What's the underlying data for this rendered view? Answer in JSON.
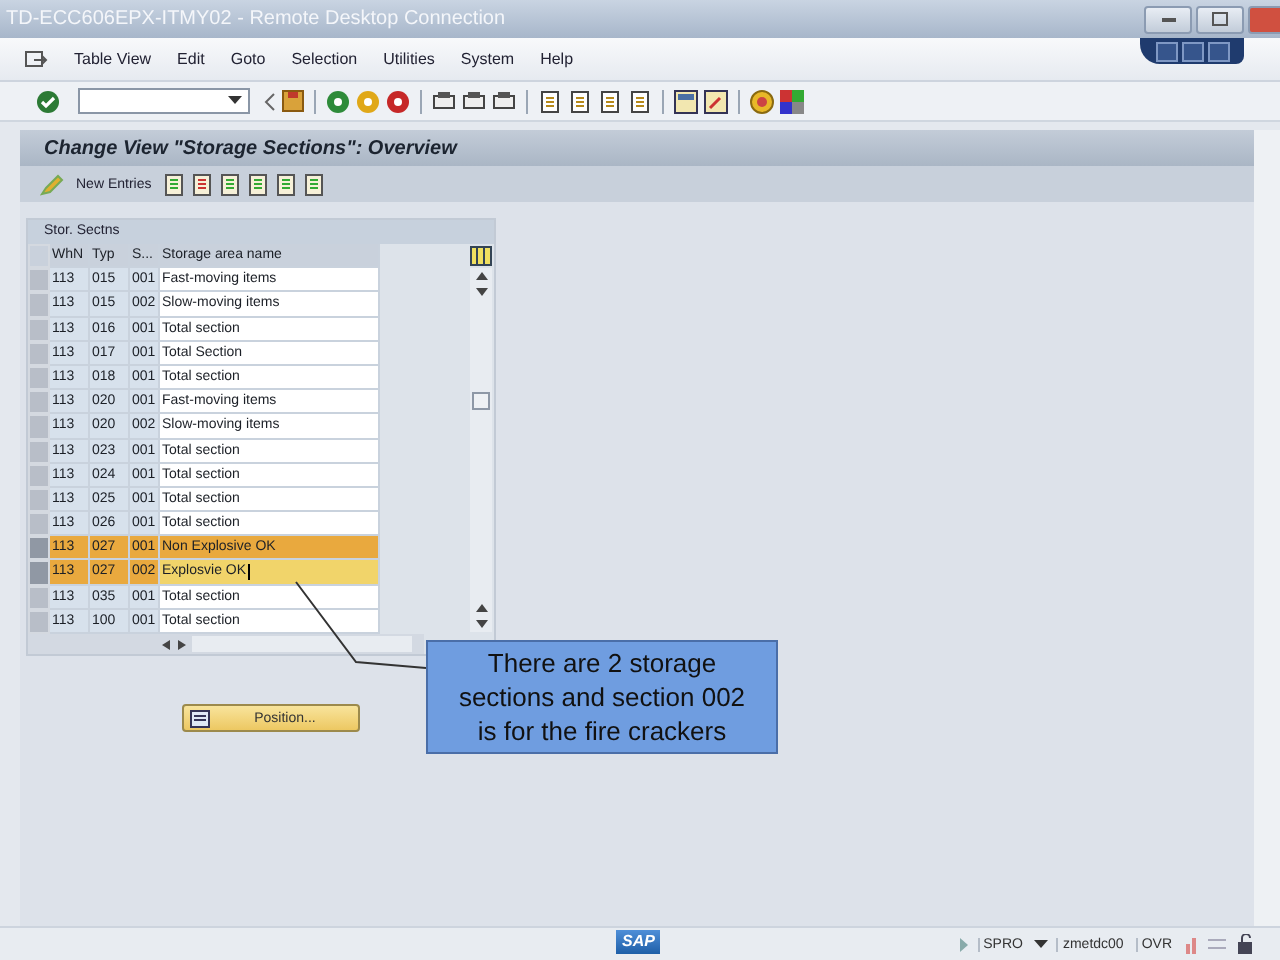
{
  "window": {
    "title": "TD-ECC606EPX-ITMY02 - Remote Desktop Connection"
  },
  "menu": [
    "Table View",
    "Edit",
    "Goto",
    "Selection",
    "Utilities",
    "System",
    "Help"
  ],
  "screen_title": "Change View \"Storage Sections\": Overview",
  "app_toolbar": {
    "new_entries": "New Entries"
  },
  "table": {
    "title": "Stor. Sectns",
    "columns": [
      "WhN",
      "Typ",
      "S...",
      "Storage area name"
    ],
    "rows": [
      {
        "cells": [
          "113",
          "015",
          "001",
          "Fast-moving items"
        ],
        "selected": false,
        "editing": false
      },
      {
        "cells": [
          "113",
          "015",
          "002",
          "Slow-moving items"
        ],
        "selected": false,
        "editing": false
      },
      {
        "cells": [
          "113",
          "016",
          "001",
          "Total section"
        ],
        "selected": false,
        "editing": false
      },
      {
        "cells": [
          "113",
          "017",
          "001",
          "Total Section"
        ],
        "selected": false,
        "editing": false
      },
      {
        "cells": [
          "113",
          "018",
          "001",
          "Total section"
        ],
        "selected": false,
        "editing": false
      },
      {
        "cells": [
          "113",
          "020",
          "001",
          "Fast-moving items"
        ],
        "selected": false,
        "editing": false
      },
      {
        "cells": [
          "113",
          "020",
          "002",
          "Slow-moving items"
        ],
        "selected": false,
        "editing": false
      },
      {
        "cells": [
          "113",
          "023",
          "001",
          "Total section"
        ],
        "selected": false,
        "editing": false
      },
      {
        "cells": [
          "113",
          "024",
          "001",
          "Total section"
        ],
        "selected": false,
        "editing": false
      },
      {
        "cells": [
          "113",
          "025",
          "001",
          "Total section"
        ],
        "selected": false,
        "editing": false
      },
      {
        "cells": [
          "113",
          "026",
          "001",
          "Total section"
        ],
        "selected": false,
        "editing": false
      },
      {
        "cells": [
          "113",
          "027",
          "001",
          "Non Explosive OK"
        ],
        "selected": true,
        "editing": false
      },
      {
        "cells": [
          "113",
          "027",
          "002",
          "Explosvie OK"
        ],
        "selected": true,
        "editing": true
      },
      {
        "cells": [
          "113",
          "035",
          "001",
          "Total section"
        ],
        "selected": false,
        "editing": false
      },
      {
        "cells": [
          "113",
          "100",
          "001",
          "Total section"
        ],
        "selected": false,
        "editing": false
      }
    ]
  },
  "callout": "There are 2 storage sections and section 002 is for the fire crackers",
  "position_button": "Position...",
  "status_bar": {
    "logo": "SAP",
    "transaction": "SPRO",
    "server": "zmetdc00",
    "mode": "OVR"
  }
}
